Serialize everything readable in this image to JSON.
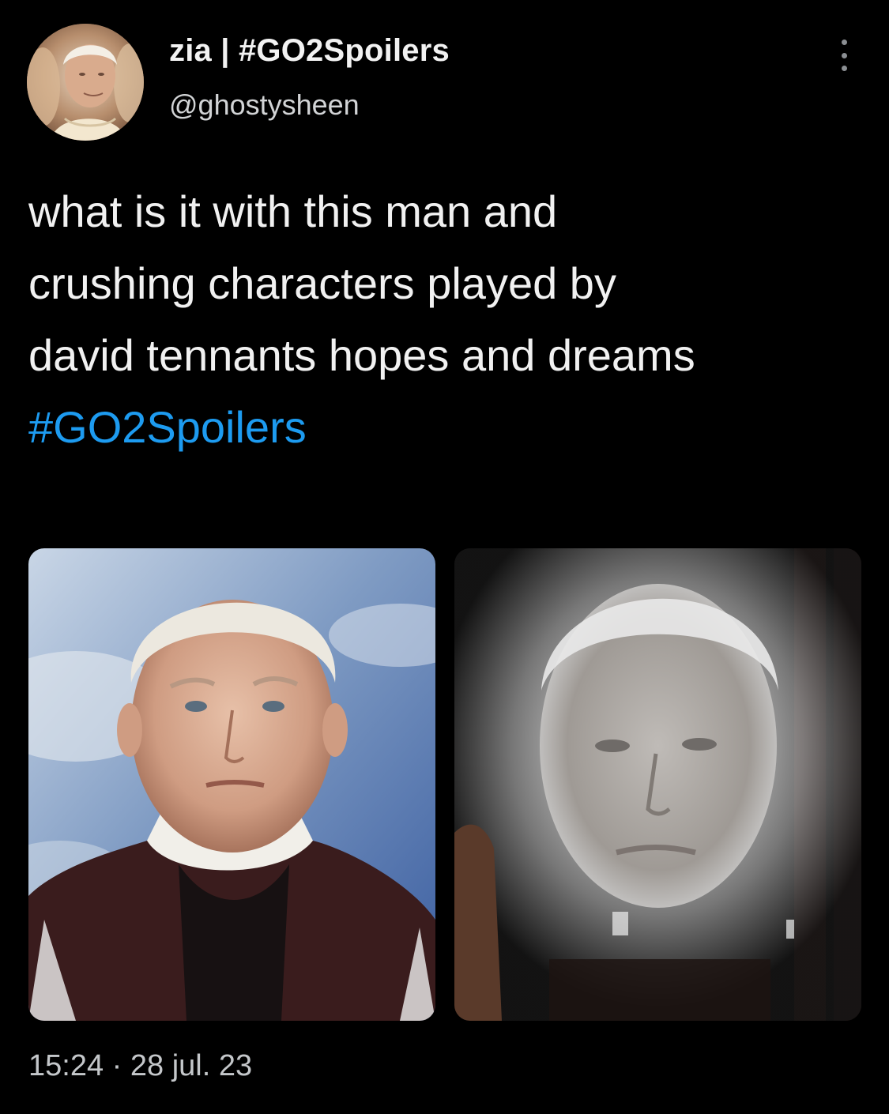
{
  "tweet": {
    "author": {
      "display_name": "zia | #GO2Spoilers",
      "handle": "@ghostysheen"
    },
    "more_icon": "more-vertical-icon",
    "text_lines": [
      "what is it with this man and",
      "crushing characters played by",
      "david tennants hopes and dreams"
    ],
    "hashtag": "#GO2Spoilers",
    "time": "15:24",
    "separator": "·",
    "date": "28 jul. 23",
    "colors": {
      "background": "#000000",
      "text": "#f1f1f1",
      "hashtag": "#1d9bf0",
      "secondary": "#c4c7ca"
    }
  }
}
